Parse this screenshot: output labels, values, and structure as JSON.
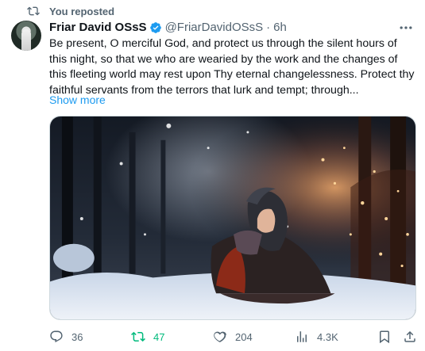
{
  "repost_context": {
    "label": "You reposted"
  },
  "tweet": {
    "author_name": "Friar David OSsS",
    "handle": "@FriarDavidOSsS",
    "separator": "·",
    "timestamp": "6h",
    "text": "Be present, O merciful God, and protect us through the silent hours of this night, so that we who are wearied by the work and the changes of this fleeting world may rest upon Thy eternal changelessness. Protect thy faithful servants from the terrors that lurk and tempt; through...",
    "show_more": "Show more"
  },
  "actions": {
    "replies": "36",
    "reposts": "47",
    "likes": "204",
    "views": "4.3K"
  },
  "colors": {
    "accent": "#1d9bf0",
    "repost_active": "#00ba7c",
    "muted": "#536471"
  },
  "icons": [
    "repost-icon",
    "verified-badge-icon",
    "more-options-icon",
    "reply-icon",
    "like-icon",
    "views-icon",
    "bookmark-icon",
    "share-icon"
  ]
}
